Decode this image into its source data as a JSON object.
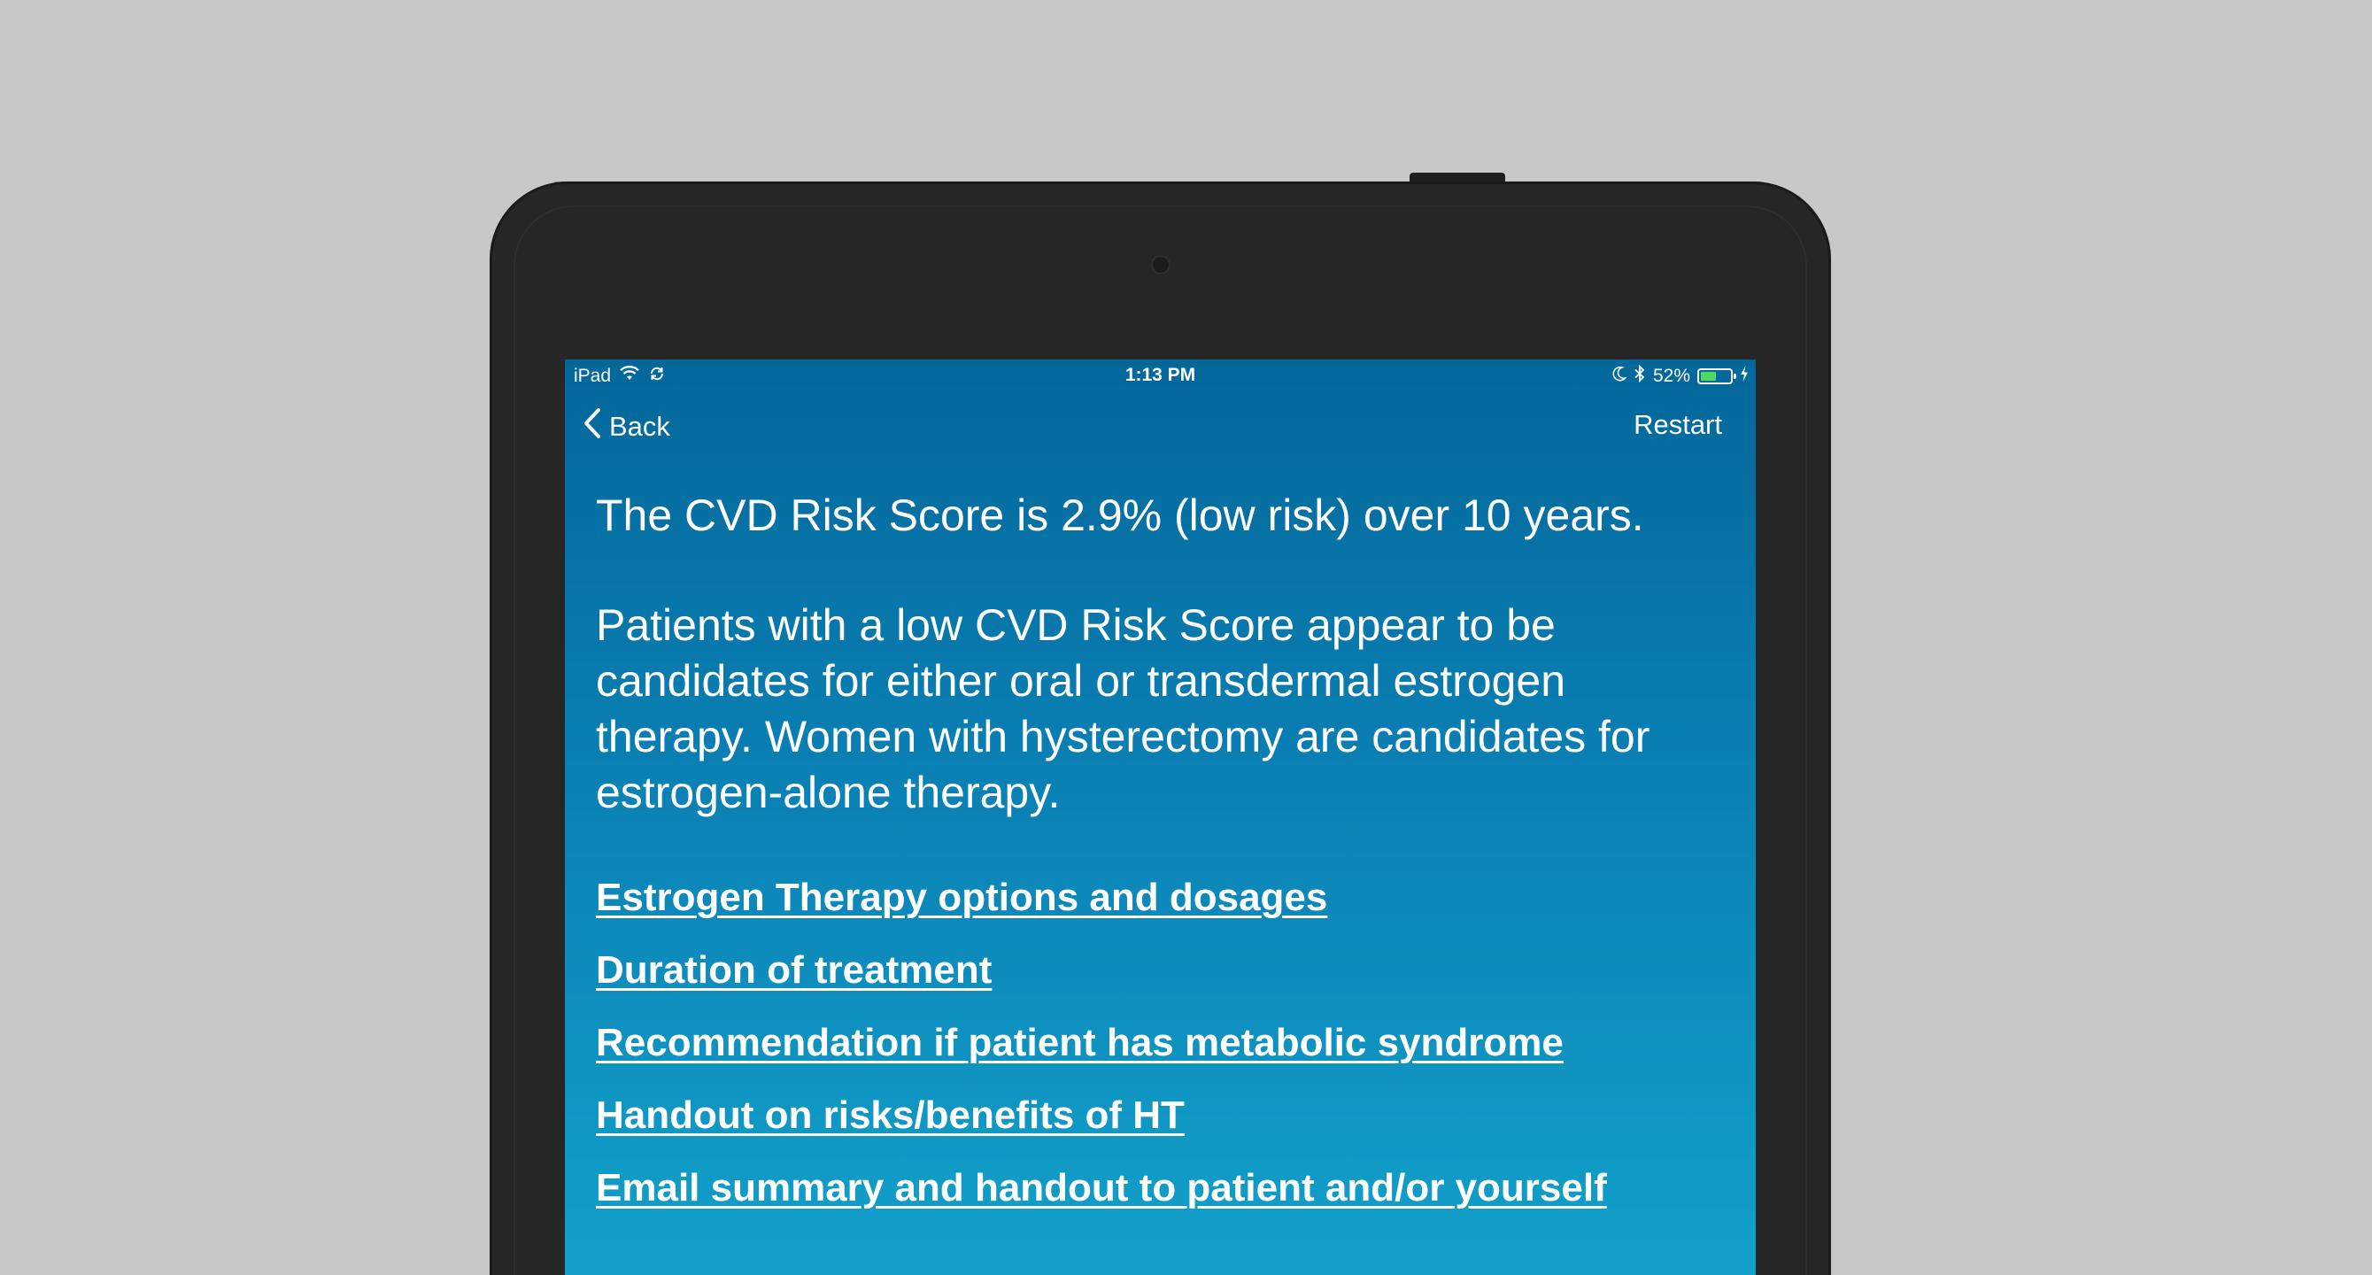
{
  "status_bar": {
    "device": "iPad",
    "time": "1:13 PM",
    "battery_text": "52%",
    "battery_level": 0.52,
    "battery_color": "#4cd964",
    "icons": [
      "wifi-icon",
      "sync-icon",
      "moon-icon",
      "bluetooth-icon",
      "battery-icon",
      "charging-icon"
    ]
  },
  "nav": {
    "back_label": "Back",
    "restart_label": "Restart"
  },
  "content": {
    "headline": "The CVD Risk Score is 2.9% (low risk) over 10 years.",
    "paragraph": "Patients with a low CVD Risk Score appear to be candidates for either oral or transdermal estrogen therapy. Women with hysterectomy are candidates for estrogen-alone therapy.",
    "links": [
      "Estrogen Therapy options and dosages",
      "Duration of treatment",
      "Recommendation if patient has metabolic syndrome",
      "Handout on risks/benefits of HT",
      "Email summary and handout to patient and/or yourself"
    ]
  },
  "colors": {
    "background": "#c8c8c8",
    "device_frame": "#262626",
    "screen_gradient_top": "#03679a",
    "screen_gradient_bottom": "#12a1cb",
    "text": "#ffffff"
  }
}
